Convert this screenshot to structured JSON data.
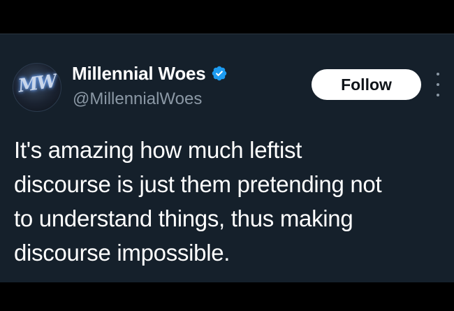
{
  "author": {
    "display_name": "Millennial Woes",
    "handle": "@MillennialWoes",
    "avatar_text": "MW",
    "verified": true
  },
  "actions": {
    "follow_label": "Follow",
    "more_icon": "more-vertical-icon"
  },
  "tweet": {
    "lines": [
      "It's amazing how much leftist",
      "discourse is just them pretending not",
      "to understand things, thus making",
      "discourse impossible."
    ]
  },
  "colors": {
    "background": "#15202b",
    "frame": "#000000",
    "text_primary": "#ffffff",
    "text_secondary": "#8b98a5",
    "verified_badge": "#1d9bf0",
    "follow_button_bg": "#ffffff",
    "follow_button_text": "#0f1419"
  }
}
